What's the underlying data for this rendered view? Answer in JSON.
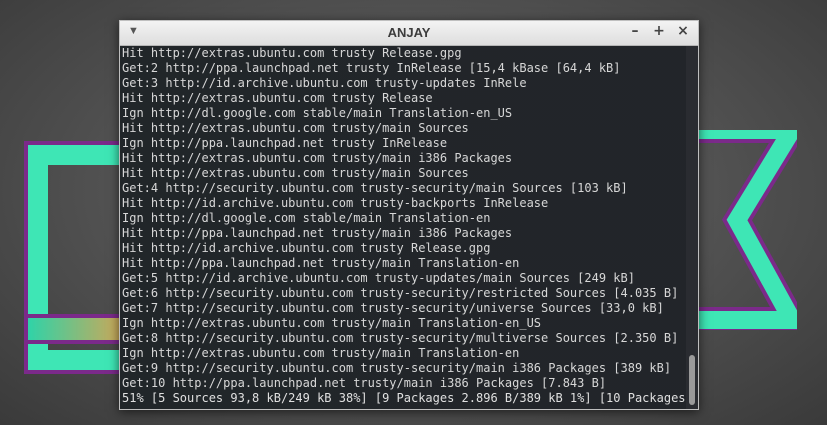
{
  "window": {
    "title": "ANJAY"
  },
  "terminal": {
    "lines": [
      "Hit http://extras.ubuntu.com trusty Release.gpg",
      "Get:2 http://ppa.launchpad.net trusty InRelease [15,4 kBase [64,4 kB]",
      "Get:3 http://id.archive.ubuntu.com trusty-updates InRele",
      "Hit http://extras.ubuntu.com trusty Release",
      "Ign http://dl.google.com stable/main Translation-en_US",
      "Hit http://extras.ubuntu.com trusty/main Sources",
      "Ign http://ppa.launchpad.net trusty InRelease",
      "Hit http://extras.ubuntu.com trusty/main i386 Packages",
      "Hit http://extras.ubuntu.com trusty/main Sources",
      "Get:4 http://security.ubuntu.com trusty-security/main Sources [103 kB]",
      "Hit http://id.archive.ubuntu.com trusty-backports InRelease",
      "Ign http://dl.google.com stable/main Translation-en",
      "Hit http://ppa.launchpad.net trusty/main i386 Packages",
      "Hit http://id.archive.ubuntu.com trusty Release.gpg",
      "Hit http://ppa.launchpad.net trusty/main Translation-en",
      "Get:5 http://id.archive.ubuntu.com trusty-updates/main Sources [249 kB]",
      "Get:6 http://security.ubuntu.com trusty-security/restricted Sources [4.035 B]",
      "Get:7 http://security.ubuntu.com trusty-security/universe Sources [33,0 kB]",
      "Ign http://extras.ubuntu.com trusty/main Translation-en_US",
      "Get:8 http://security.ubuntu.com trusty-security/multiverse Sources [2.350 B]",
      "Ign http://extras.ubuntu.com trusty/main Translation-en",
      "Get:9 http://security.ubuntu.com trusty-security/main i386 Packages [389 kB]",
      "Get:10 http://ppa.launchpad.net trusty/main i386 Packages [7.843 B]"
    ],
    "status_line": "51% [5 Sources 93,8 kB/249 kB 38%] [9 Packages 2.896 B/389 kB 1%] [10 Packages "
  },
  "colors": {
    "terminal_bg": "#2a2c31",
    "text": "#d7d7d7",
    "cursor": "#2a6fbf",
    "wallpaper_green": "#3ee6b5",
    "wallpaper_purple": "#7b2a8a"
  },
  "icons": {
    "menu": "chevron-down-icon",
    "minimize": "minimize-icon",
    "maximize": "maximize-icon",
    "close": "close-icon"
  }
}
